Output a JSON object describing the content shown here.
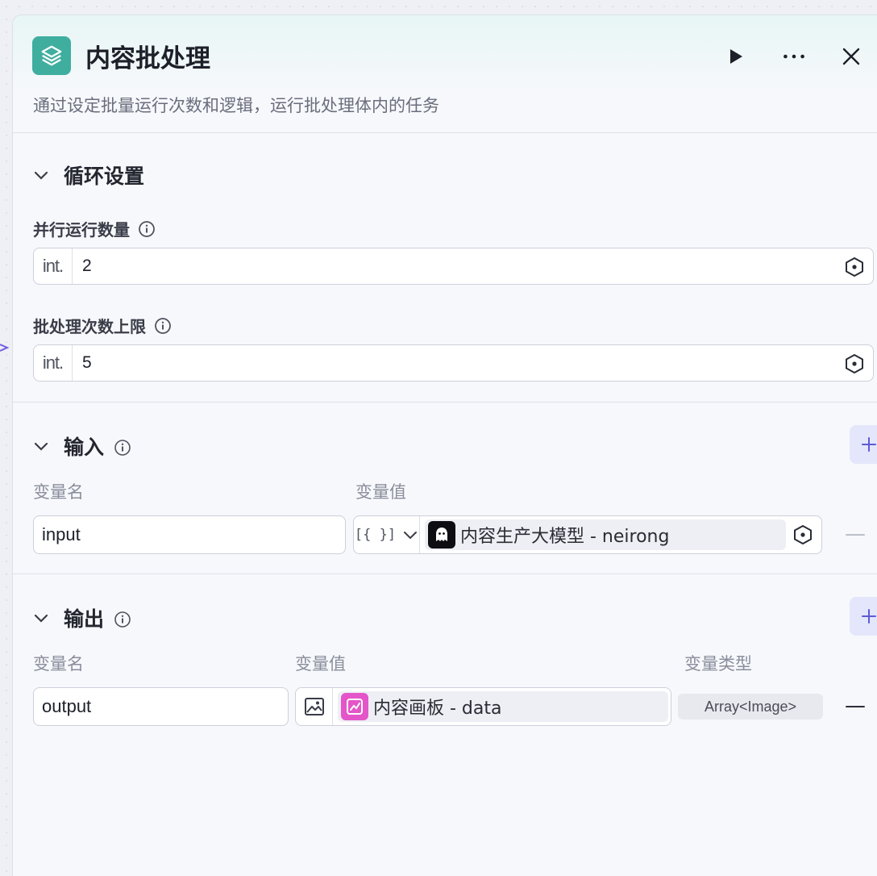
{
  "node": {
    "title": "内容批处理",
    "description": "通过设定批量运行次数和逻辑，运行批处理体内的任务",
    "icon": "layers-icon",
    "accent": "#3fae9f"
  },
  "loop_settings": {
    "title": "循环设置",
    "parallel": {
      "label": "并行运行数量",
      "type": "int.",
      "value": "2"
    },
    "limit": {
      "label": "批处理次数上限",
      "type": "int.",
      "value": "5"
    }
  },
  "inputs": {
    "title": "输入",
    "col_name": "变量名",
    "col_value": "变量值",
    "rows": [
      {
        "name": "input",
        "type_symbol": "[{ }]",
        "source_label": "内容生产大模型 - neirong",
        "source_icon": "ghost-icon"
      }
    ]
  },
  "outputs": {
    "title": "输出",
    "col_name": "变量名",
    "col_value": "变量值",
    "col_type": "变量类型",
    "rows": [
      {
        "name": "output",
        "source_label": "内容画板 - data",
        "source_icon": "canvas-icon",
        "var_type": "Array<Image>"
      }
    ]
  },
  "colors": {
    "accent_purple": "#5b5bd6",
    "canvas_pink": "#e455c9"
  }
}
